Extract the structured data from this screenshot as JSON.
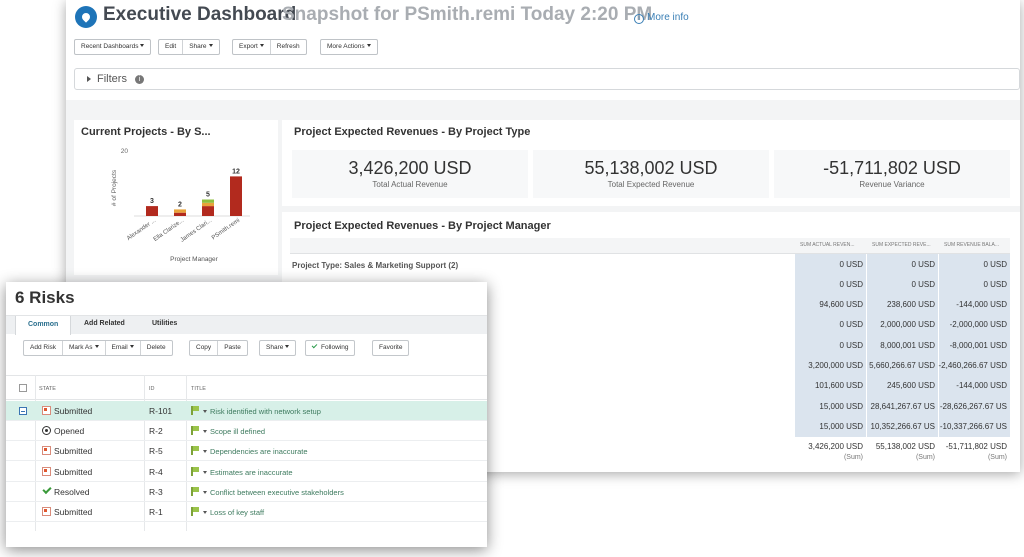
{
  "dashboard": {
    "title": "Executive Dashboard",
    "subtitle": "Snapshot for PSmith.remi Today 2:20 PM",
    "more_info": "More info",
    "toolbar": {
      "recent": "Recent Dashboards",
      "edit": "Edit",
      "share": "Share",
      "export": "Export",
      "refresh": "Refresh",
      "more_actions": "More Actions"
    },
    "filters_label": "Filters",
    "current_projects": {
      "title": "Current Projects - By S...",
      "chart_data": {
        "type": "bar",
        "title": "Current Projects - By S...",
        "xlabel": "Project Manager",
        "ylabel": "# of Projects",
        "ylim": [
          0,
          20
        ],
        "y_ticks": [
          "20"
        ],
        "categories": [
          "Alexander ...",
          "Ella Clarize...",
          "James Clari...",
          "PSmith.remi"
        ],
        "totals": [
          3,
          2,
          5,
          12
        ],
        "series": [
          {
            "color": "#b22a1e",
            "values": [
              3,
              1,
              3,
              12
            ]
          },
          {
            "color": "#e8a33a",
            "values": [
              0,
              1,
              1,
              0
            ]
          },
          {
            "color": "#8fbf3f",
            "values": [
              0,
              0,
              1,
              0
            ]
          }
        ]
      }
    },
    "revenues_by_type": {
      "title": "Project Expected Revenues - By Project Type",
      "kpis": [
        {
          "value": "3,426,200 USD",
          "label": "Total Actual Revenue"
        },
        {
          "value": "55,138,002 USD",
          "label": "Total Expected Revenue"
        },
        {
          "value": "-51,711,802 USD",
          "label": "Revenue Variance"
        }
      ]
    },
    "revenues_by_manager": {
      "title": "Project Expected Revenues - By Project Manager",
      "columns": [
        "SUM ACTUAL REVEN...",
        "SUM EXPECTED REVE...",
        "SUM REVENUE BALA..."
      ],
      "group_label": "Project Type: Sales & Marketing Support (2)",
      "rows": [
        [
          "0 USD",
          "0 USD",
          "0 USD"
        ],
        [
          "0 USD",
          "0 USD",
          "0 USD"
        ],
        [
          "94,600 USD",
          "238,600 USD",
          "-144,000 USD"
        ],
        [
          "0 USD",
          "2,000,000 USD",
          "-2,000,000 USD"
        ],
        [
          "0 USD",
          "8,000,001 USD",
          "-8,000,001 USD"
        ],
        [
          "3,200,000 USD",
          "5,660,266.67 USD",
          "-2,460,266.67 USD"
        ],
        [
          "101,600 USD",
          "245,600 USD",
          "-144,000 USD"
        ],
        [
          "15,000 USD",
          "28,641,267.67 US",
          "-28,626,267.67 US"
        ],
        [
          "15,000 USD",
          "10,352,266.67 US",
          "-10,337,266.67 US"
        ]
      ],
      "totals": [
        "3,426,200 USD",
        "55,138,002 USD",
        "-51,711,802 USD"
      ],
      "sum_label": "(Sum)"
    }
  },
  "risks": {
    "title": "6 Risks",
    "tabs": [
      "Common",
      "Add Related",
      "Utilities"
    ],
    "toolbar": {
      "add_risk": "Add Risk",
      "mark_as": "Mark As",
      "email": "Email",
      "delete": "Delete",
      "copy": "Copy",
      "paste": "Paste",
      "share": "Share",
      "following": "Following",
      "favorite": "Favorite"
    },
    "columns": [
      "STATE",
      "ID",
      "TITLE"
    ],
    "rows": [
      {
        "state": "Submitted",
        "state_icon": "submitted-icon",
        "id": "R-101",
        "title": "Risk identified with network setup",
        "selected": true
      },
      {
        "state": "Opened",
        "state_icon": "opened-icon",
        "id": "R-2",
        "title": "Scope ill defined",
        "selected": false
      },
      {
        "state": "Submitted",
        "state_icon": "submitted-icon",
        "id": "R-5",
        "title": "Dependencies are inaccurate",
        "selected": false
      },
      {
        "state": "Submitted",
        "state_icon": "submitted-icon",
        "id": "R-4",
        "title": "Estimates are inaccurate",
        "selected": false
      },
      {
        "state": "Resolved",
        "state_icon": "resolved-icon",
        "id": "R-3",
        "title": "Conflict between executive stakeholders",
        "selected": false
      },
      {
        "state": "Submitted",
        "state_icon": "submitted-icon",
        "id": "R-1",
        "title": "Loss of key staff",
        "selected": false
      }
    ]
  }
}
